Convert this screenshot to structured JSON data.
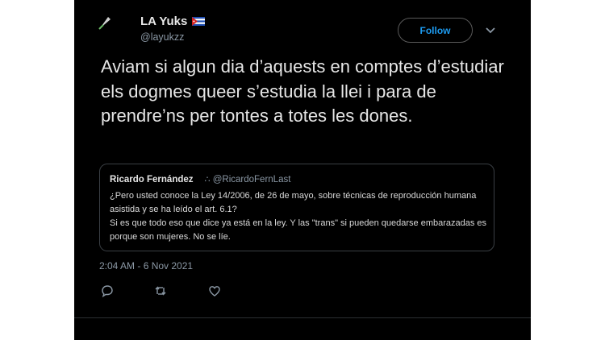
{
  "tweet": {
    "display_name": "LA Yuks",
    "handle": "@layukzz",
    "follow_label": "Follow",
    "text": "Aviam si algun dia d’aquests en comptes d’estudiar els dogmes queer s’estudia la llei i para de prendre’ns per tontes a totes les dones.",
    "timestamp": "2:04 AM - 6 Nov 2021",
    "name_flag": "cuba-flag"
  },
  "quoted_tweet": {
    "display_name": "Ricardo Fernández",
    "badge_glyph": "∴",
    "handle": "@RicardoFernLast",
    "text_line1": "¿Pero usted conoce la Ley 14/2006, de 26 de mayo, sobre técnicas de reproducción humana asistida y se ha leído el art. 6.1?",
    "text_line2": "Si es que todo eso que dice ya está en la ley. Y las \"trans\" si pueden quedarse embarazadas es porque son mujeres. No se líe."
  },
  "actions": {
    "icons": [
      "reply-icon",
      "retweet-icon",
      "like-icon"
    ]
  },
  "colors": {
    "background": "#000000",
    "accent": "#1d9bf0",
    "muted": "#8b98a5"
  }
}
